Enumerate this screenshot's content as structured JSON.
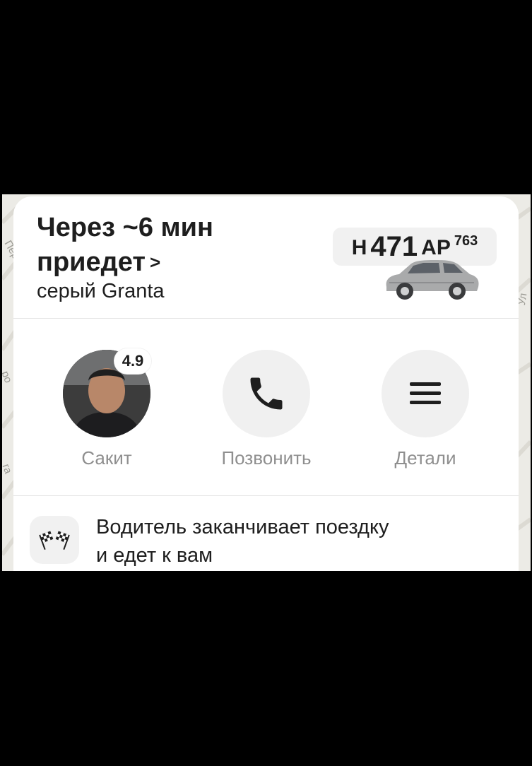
{
  "map": {
    "labels": [
      "Пер",
      "Ул",
      "ро",
      "га"
    ]
  },
  "ride": {
    "eta_line1": "Через ~6 мин",
    "eta_line2": "приедет",
    "chevron": ">",
    "car_description": "серый Granta",
    "plate": {
      "letter1": "Н",
      "digits": "471",
      "letters2": "АР",
      "region": "763"
    },
    "car_icon": "car-icon"
  },
  "actions": {
    "driver": {
      "name": "Сакит",
      "rating": "4.9"
    },
    "call": {
      "label": "Позвонить",
      "icon": "phone-icon"
    },
    "details": {
      "label": "Детали",
      "icon": "menu-icon"
    }
  },
  "status": {
    "line1": "Водитель заканчивает поездку",
    "line2": "и едет к вам",
    "icon": "flags-icon"
  },
  "colors": {
    "card_bg": "#ffffff",
    "circle_bg": "#f0f0f0",
    "text_main": "#1e1e1e",
    "text_muted": "#8f8f8f"
  }
}
